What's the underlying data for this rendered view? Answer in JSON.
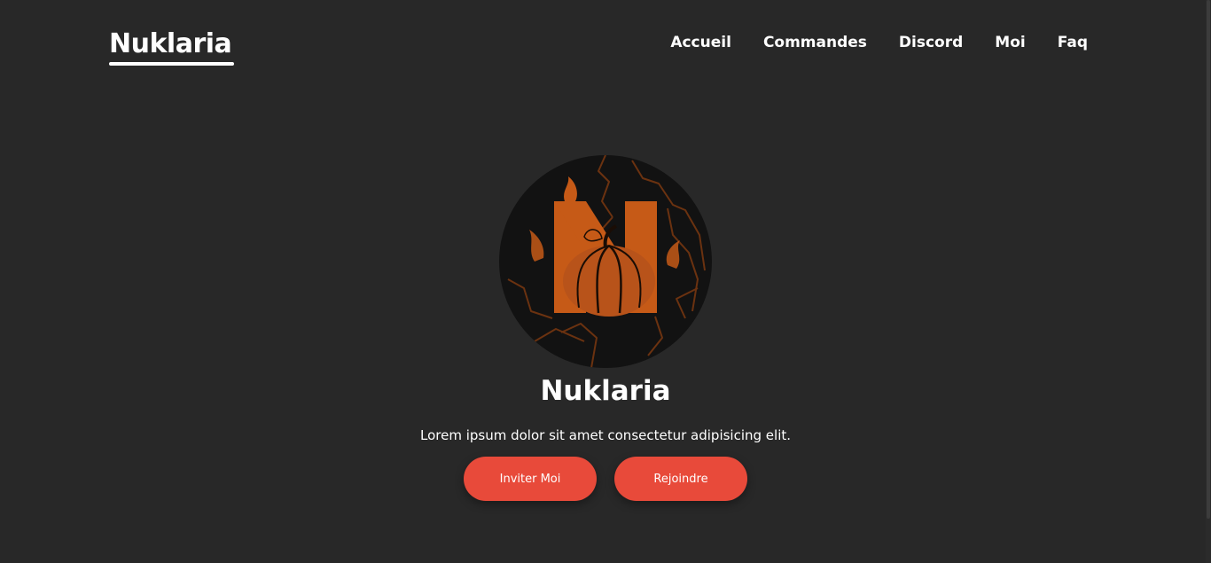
{
  "colors": {
    "background": "#282828",
    "text": "#ffffff",
    "accent": "#e84a3a",
    "logo_orange": "#c65a17",
    "logo_dark": "#121212"
  },
  "header": {
    "brand": "Nuklaria",
    "nav": [
      "Accueil",
      "Commandes",
      "Discord",
      "Moi",
      "Faq"
    ]
  },
  "hero": {
    "avatar_icon": "pumpkin-n-logo-icon",
    "title": "Nuklaria",
    "description": "Lorem ipsum dolor sit amet consectetur adipisicing elit.",
    "buttons": {
      "invite": "Inviter Moi",
      "join": "Rejoindre"
    }
  }
}
